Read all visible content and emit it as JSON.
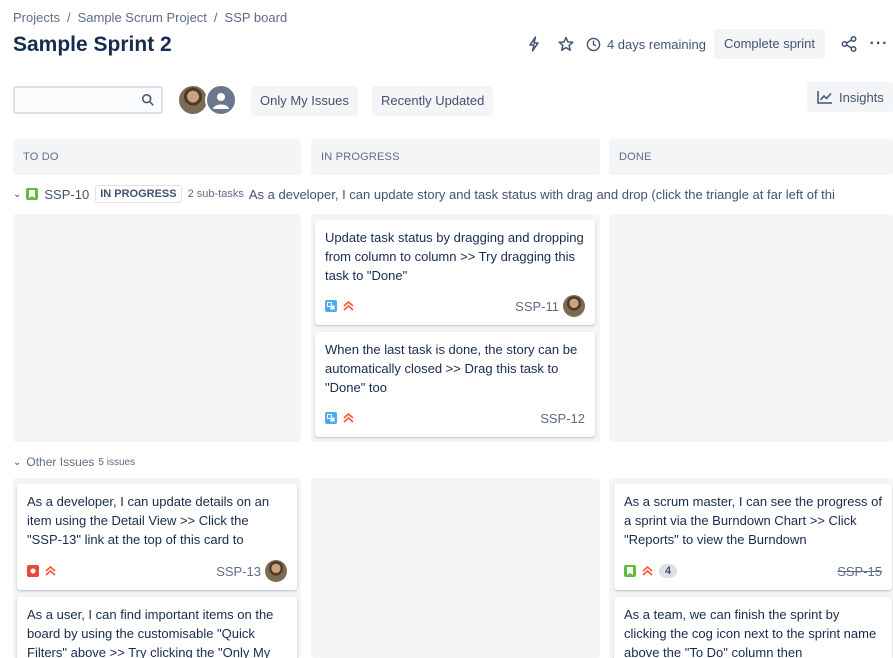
{
  "breadcrumb": [
    "Projects",
    "Sample Scrum Project",
    "SSP board"
  ],
  "breadcrumb_separator": "/",
  "sprint_title": "Sample Sprint 2",
  "header": {
    "days_remaining": "4 days remaining",
    "complete_sprint_label": "Complete sprint",
    "more_label": "···"
  },
  "search": {
    "value": "",
    "placeholder": ""
  },
  "filters": {
    "only_my_issues": "Only My Issues",
    "recently_updated": "Recently Updated",
    "insights": "Insights"
  },
  "columns": [
    "TO DO",
    "IN PROGRESS",
    "DONE"
  ],
  "story_swimlane": {
    "key": "SSP-10",
    "status": "IN PROGRESS",
    "subtasks": "2 sub-tasks",
    "summary": "As a developer, I can update story and task status with drag and drop (click the triangle at far left of thi"
  },
  "story_cards": [
    {
      "summary": "Update task status by dragging and dropping from column to column >> Try dragging this task to \"Done\"",
      "key": "SSP-11"
    },
    {
      "summary": "When the last task is done, the story can be automatically closed >> Drag this task to \"Done\" too",
      "key": "SSP-12"
    }
  ],
  "other_issues": {
    "label": "Other Issues",
    "count": "5 issues"
  },
  "todo_cards": [
    {
      "summary": "As a developer, I can update details on an item using the Detail View >> Click the \"SSP-13\" link at the top of this card to",
      "key": "SSP-13"
    },
    {
      "summary": "As a user, I can find important items on the board by using the customisable \"Quick Filters\" above >> Try clicking the \"Only My"
    }
  ],
  "done_cards": [
    {
      "summary": "As a scrum master, I can see the progress of a sprint via the Burndown Chart >> Click \"Reports\" to view the Burndown",
      "estimate": "4",
      "key": "SSP-15"
    },
    {
      "summary": "As a team, we can finish the sprint by clicking the cog icon next to the sprint name above the \"To Do\" column then"
    }
  ],
  "colors": {
    "subtask": "#4bade8",
    "bug": "#e5493a",
    "story": "#63ba3c",
    "priority_high": "#ff5630",
    "column_bg": "#f4f5f7"
  }
}
